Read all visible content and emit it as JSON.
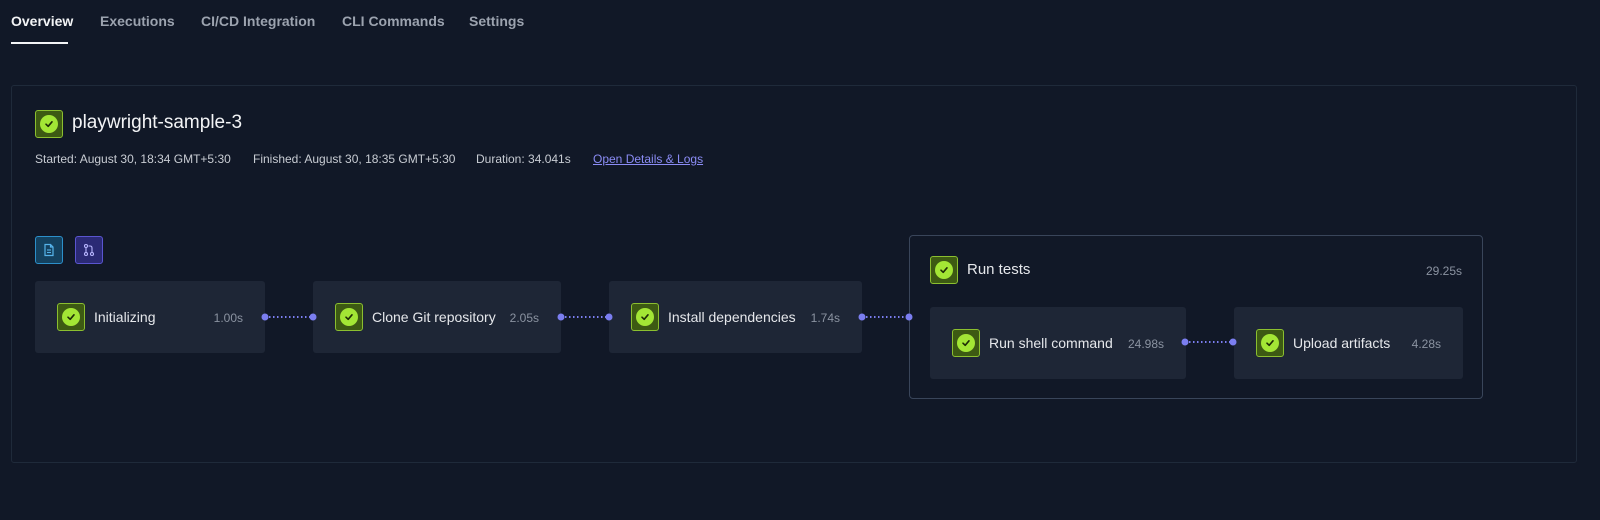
{
  "tabs": [
    {
      "label": "Overview",
      "active": true
    },
    {
      "label": "Executions",
      "active": false
    },
    {
      "label": "CI/CD Integration",
      "active": false
    },
    {
      "label": "CLI Commands",
      "active": false
    },
    {
      "label": "Settings",
      "active": false
    }
  ],
  "workflow": {
    "name": "playwright-sample-3",
    "status": "passed",
    "started": "Started: August 30, 18:34 GMT+5:30",
    "finished": "Finished: August 30, 18:35 GMT+5:30",
    "duration": "Duration: 34.041s",
    "details_link": "Open Details & Logs"
  },
  "toolbar": {
    "icons": [
      "document-icon",
      "git-branch-icon"
    ]
  },
  "steps": [
    {
      "label": "Initializing",
      "duration": "1.00s",
      "status": "passed"
    },
    {
      "label": "Clone Git repository",
      "duration": "2.05s",
      "status": "passed"
    },
    {
      "label": "Install dependencies",
      "duration": "1.74s",
      "status": "passed"
    }
  ],
  "group": {
    "label": "Run tests",
    "duration": "29.25s",
    "status": "passed",
    "steps": [
      {
        "label": "Run shell command",
        "duration": "24.98s",
        "status": "passed"
      },
      {
        "label": "Upload artifacts",
        "duration": "4.28s",
        "status": "passed"
      }
    ]
  },
  "colors": {
    "background": "#111827",
    "card": "#1e2636",
    "success": "#a3e635",
    "connector": "#7b7ef0",
    "link": "#8b8cf5"
  }
}
